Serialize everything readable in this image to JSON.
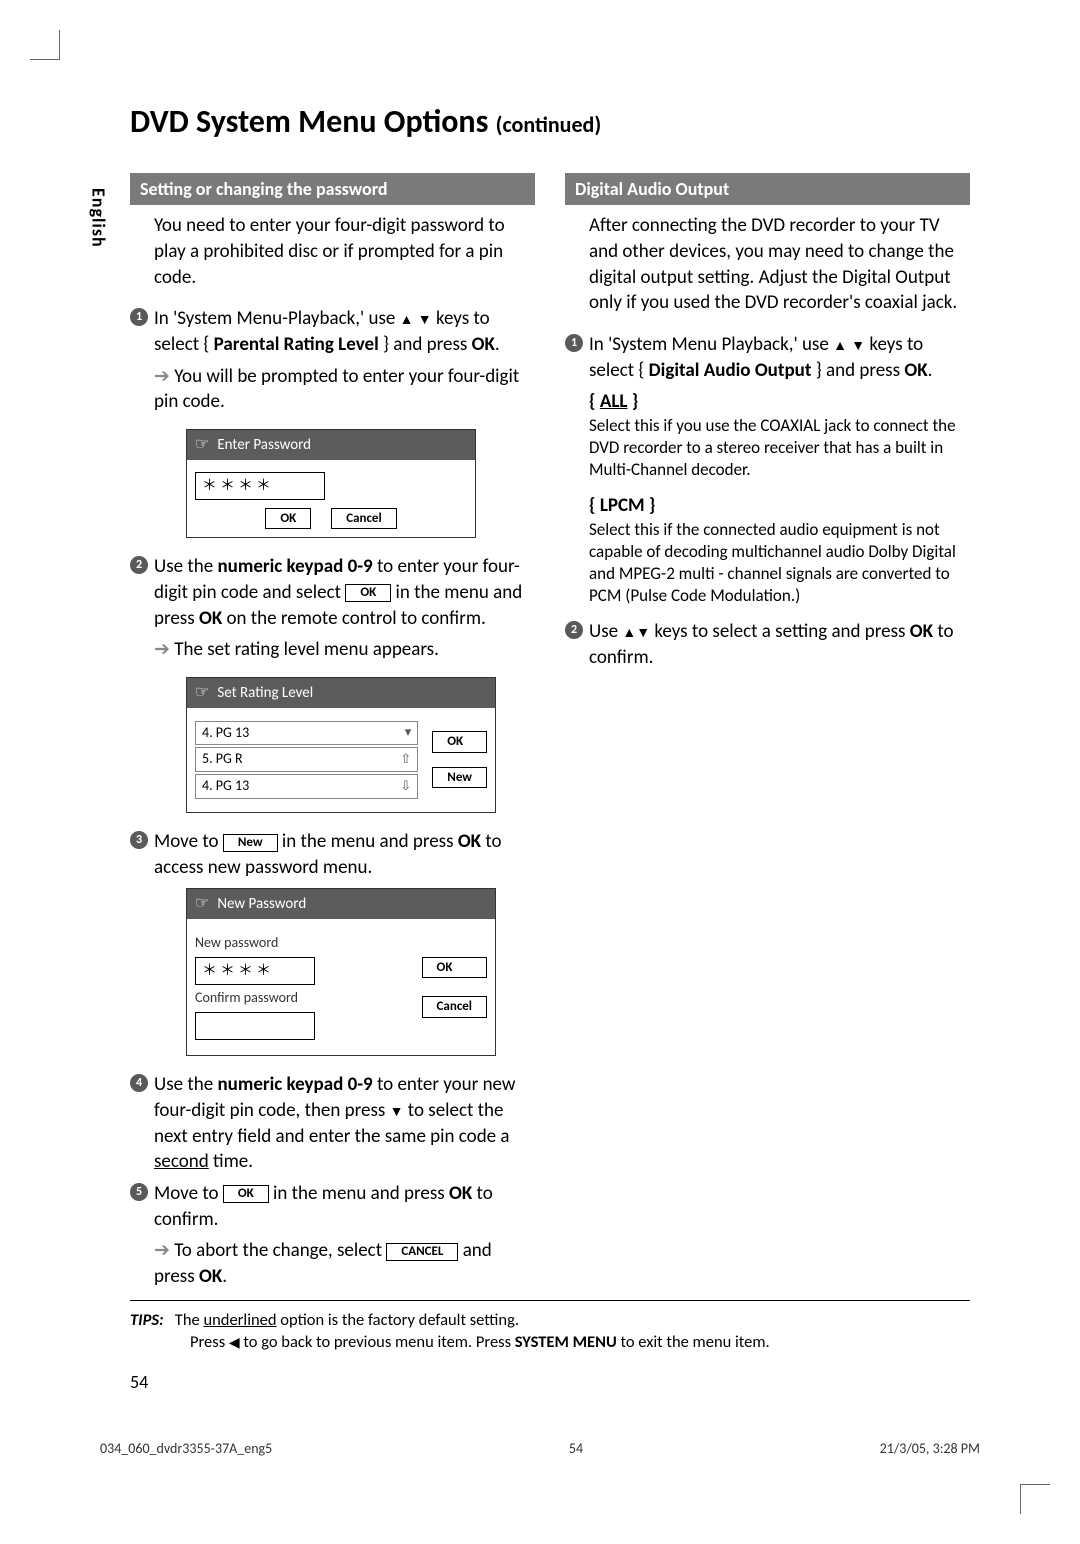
{
  "lang_tab": "English",
  "title_main": "DVD System Menu Options",
  "title_cont": "(continued)",
  "left": {
    "section": "Setting or changing the password",
    "intro": "You need to enter your four-digit password to play a prohibited disc or if prompted for a pin code.",
    "step1_a": "In 'System Menu-Playback,' use ",
    "step1_b": " keys to select { ",
    "step1_c": "Parental Rating Level",
    "step1_d": " } and press ",
    "step1_ok": "OK",
    "step1_e": ".",
    "arrow1": "You will be prompted to enter your four-digit pin code.",
    "osd1_title": "Enter Password",
    "osd1_value": "＊＊＊＊",
    "osd1_ok": "OK",
    "osd1_cancel": "Cancel",
    "step2_a": "Use the ",
    "step2_b": "numeric keypad 0-9",
    "step2_c": " to enter your four-digit pin code and select ",
    "step2_btn": "OK",
    "step2_d": " in the menu and press ",
    "step2_ok": "OK",
    "step2_e": " on the remote control to confirm.",
    "arrow2": "The set rating level menu appears.",
    "osd2_title": "Set Rating Level",
    "osd2_item1": "4.  PG 13",
    "osd2_item2": "5.  PG R",
    "osd2_item3": "4.  PG 13",
    "osd2_ok": "OK",
    "osd2_new": "New",
    "step3_a": "Move to ",
    "step3_btn": "New",
    "step3_b": " in the menu and press ",
    "step3_ok": "OK",
    "step3_c": " to access new password menu.",
    "osd3_title": "New Password",
    "osd3_newpw": "New password",
    "osd3_value": "＊＊＊＊",
    "osd3_conf": "Confirm password",
    "osd3_ok": "OK",
    "osd3_cancel": "Cancel",
    "step4_a": "Use the ",
    "step4_b": "numeric keypad 0-9",
    "step4_c": " to enter your new four-digit pin code, then press ",
    "step4_d": " to select the next entry field and enter the same pin code a ",
    "step4_second": "second",
    "step4_e": " time.",
    "step5_a": "Move to ",
    "step5_btn": "OK",
    "step5_b": " in the menu and press ",
    "step5_ok": "OK",
    "step5_c": " to confirm.",
    "arrow5_a": "To abort the change, select ",
    "arrow5_btn": "CANCEL",
    "arrow5_b": " and press ",
    "arrow5_ok": "OK",
    "arrow5_c": "."
  },
  "right": {
    "section": "Digital Audio Output",
    "intro": "After connecting the DVD recorder to your TV and other devices, you may need to change the digital output setting. Adjust the Digital Output only if you used the DVD recorder's coaxial jack.",
    "step1_a": "In 'System Menu Playback,' use ",
    "step1_b": " keys to select { ",
    "step1_c": "Digital Audio Output",
    "step1_d": " } and press ",
    "step1_ok": "OK",
    "step1_e": ".",
    "opt1_title": "ALL",
    "opt1_desc": "Select this if you use the COAXIAL jack to connect the DVD recorder to a stereo receiver that has a built in Multi-Channel decoder.",
    "opt2_title": "LPCM",
    "opt2_desc": "Select this if the connected audio equipment is not capable of decoding multichannel audio Dolby Digital and MPEG-2 multi - channel signals are converted to PCM (Pulse Code Modulation.)",
    "step2_a": "Use ",
    "step2_b": " keys to select a setting and press ",
    "step2_ok": "OK",
    "step2_c": " to confirm."
  },
  "tips": {
    "label": "TIPS:",
    "line1_a": "The ",
    "line1_u": "underlined",
    "line1_b": " option is the factory default setting.",
    "line2_a": "Press ",
    "line2_b": " to go back to previous menu item. Press ",
    "line2_c": "SYSTEM MENU",
    "line2_d": " to exit the menu item."
  },
  "pagenum": "54",
  "footer_left": "034_060_dvdr3355-37A_eng5",
  "footer_mid": "54",
  "footer_right": "21/3/05, 3:28 PM"
}
